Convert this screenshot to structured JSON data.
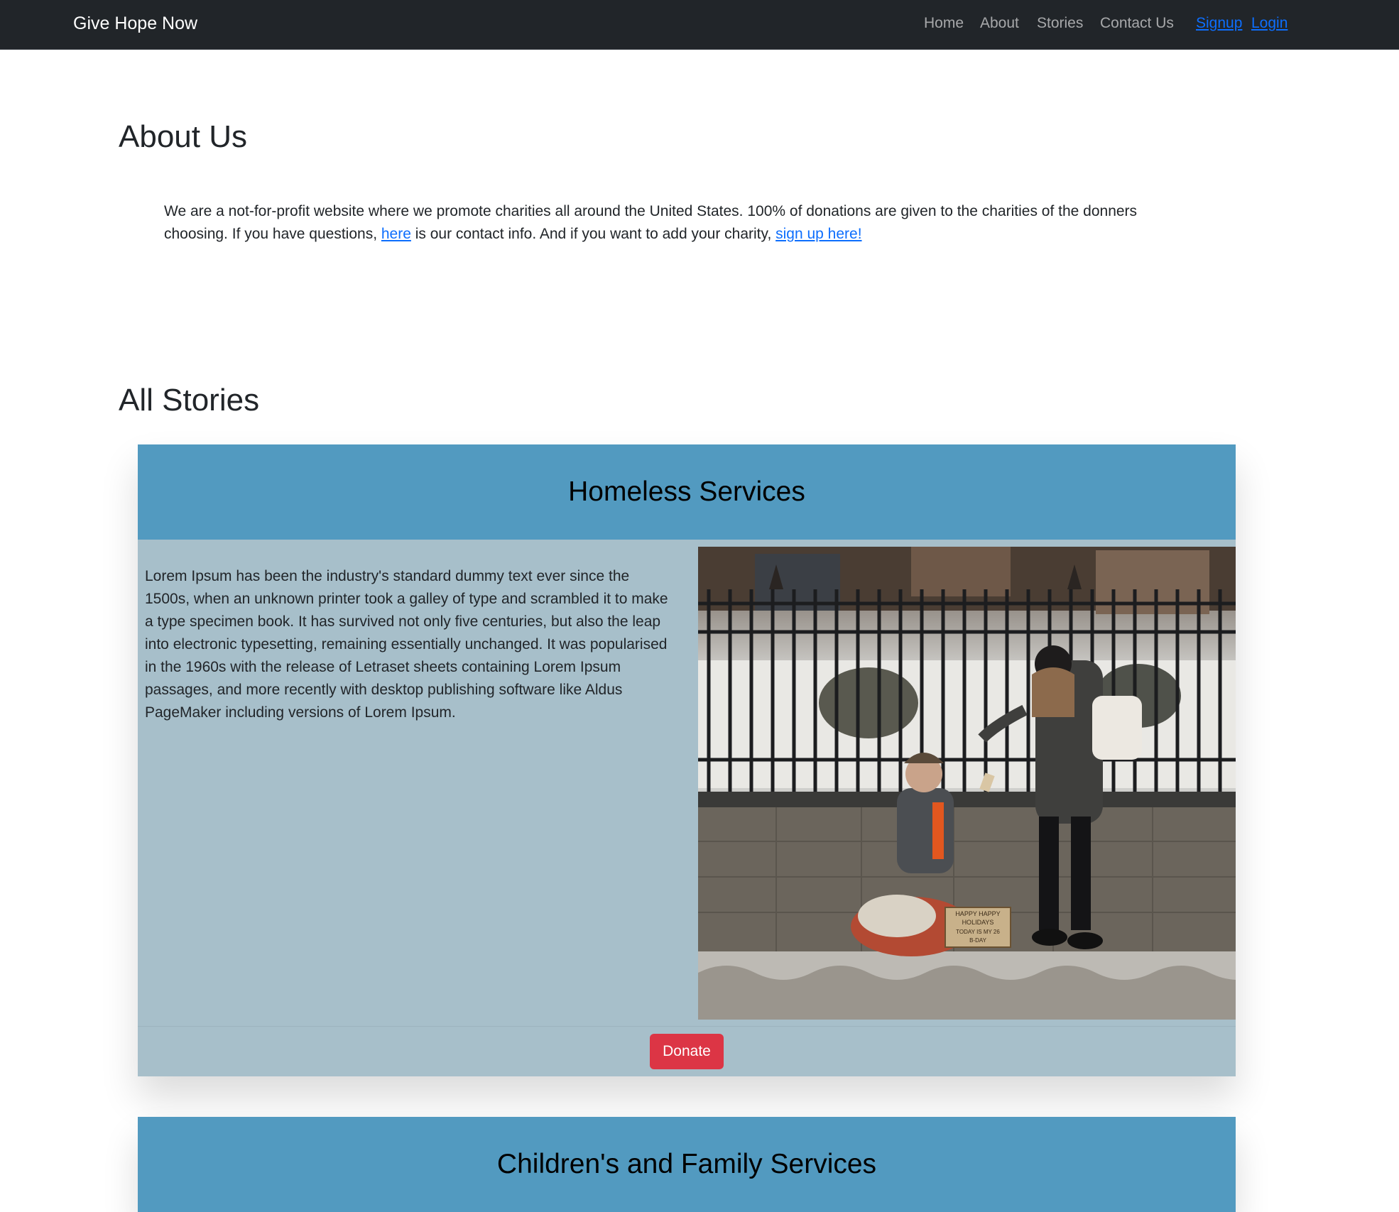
{
  "navbar": {
    "brand": "Give Hope Now",
    "links": [
      "Home",
      "About",
      "Stories",
      "Contact Us"
    ],
    "signup": "Signup",
    "login": "Login"
  },
  "about": {
    "title": "About Us",
    "text_part1": "We are a not-for-profit website where we promote charities all around the United States. 100% of donations are given to the charities of the donners choosing. If you have questions, ",
    "contact_link": "here",
    "text_part2": " is our contact info. And if you want to add your charity, ",
    "signup_link": "sign up here!"
  },
  "stories": {
    "title": "All Stories",
    "items": [
      {
        "title": "Homeless Services",
        "text": "Lorem Ipsum has been the industry's standard dummy text ever since the 1500s, when an unknown printer took a galley of type and scrambled it to make a type specimen book. It has survived not only five centuries, but also the leap into electronic typesetting, remaining essentially unchanged. It was popularised in the 1960s with the release of Letraset sheets containing Lorem Ipsum passages, and more recently with desktop publishing software like Aldus PageMaker including versions of Lorem Ipsum.",
        "sign_text": [
          "HAPPY HAPPY",
          "HOLIDAYS",
          "TODAY IS MY 26",
          "B-DAY"
        ],
        "donate_label": "Donate"
      },
      {
        "title": "Children's and Family Services"
      }
    ]
  },
  "colors": {
    "navbar_bg": "#212529",
    "card_header": "#529ac0",
    "card_body": "#a7bfca",
    "donate": "#dc3545",
    "link": "#0d6efd"
  }
}
